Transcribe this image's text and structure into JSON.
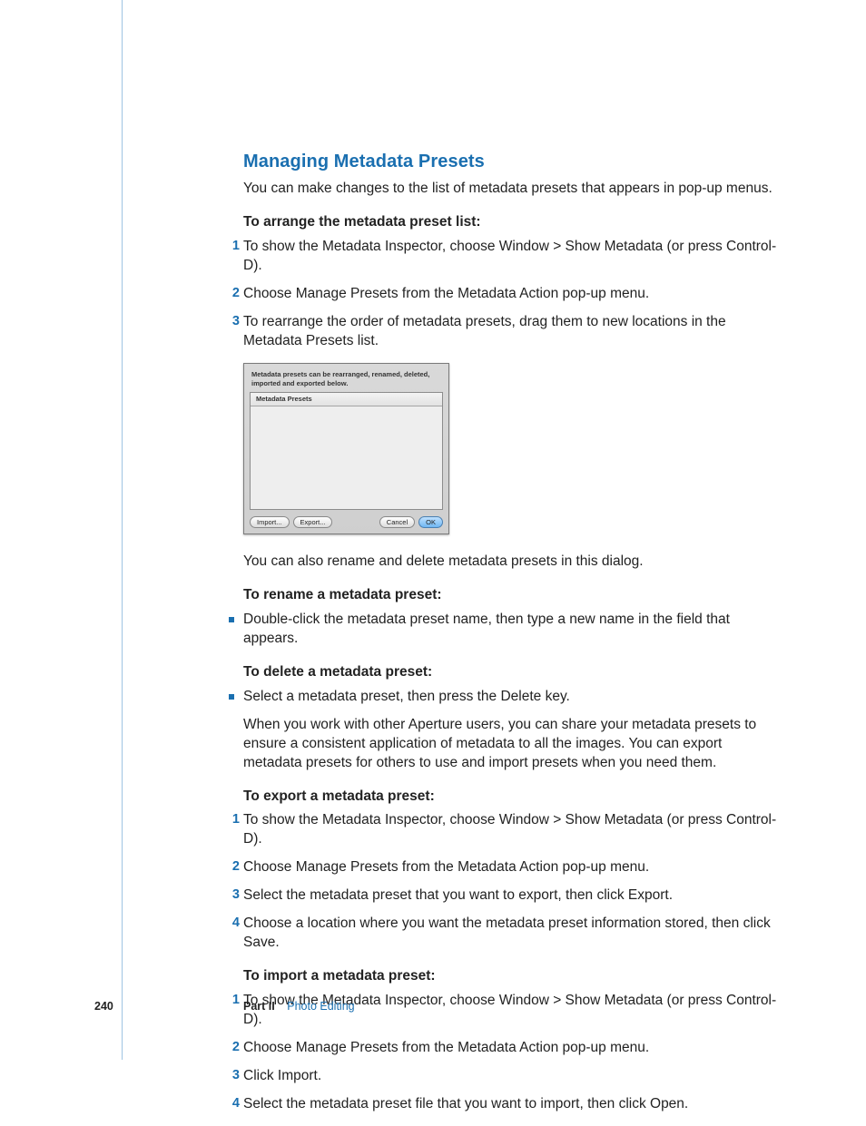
{
  "heading": "Managing Metadata Presets",
  "intro": "You can make changes to the list of metadata presets that appears in pop-up menus.",
  "arrange": {
    "head": "To arrange the metadata preset list:",
    "steps": [
      "To show the Metadata Inspector, choose Window > Show Metadata (or press Control-D).",
      "Choose Manage Presets from the Metadata Action pop-up menu.",
      "To rearrange the order of metadata presets, drag them to new locations in the Metadata Presets list."
    ]
  },
  "dialog": {
    "message": "Metadata presets can be rearranged, renamed, deleted, imported and exported below.",
    "listHeader": "Metadata Presets",
    "buttons": {
      "import": "Import...",
      "export": "Export...",
      "cancel": "Cancel",
      "ok": "OK"
    }
  },
  "afterDialog": "You can also rename and delete metadata presets in this dialog.",
  "rename": {
    "head": "To rename a metadata preset:",
    "bullet": "Double-click the metadata preset name, then type a new name in the field that appears."
  },
  "delete": {
    "head": "To delete a metadata preset:",
    "bullet": "Select a metadata preset, then press the Delete key.",
    "para": "When you work with other Aperture users, you can share your metadata presets to ensure a consistent application of metadata to all the images. You can export metadata presets for others to use and import presets when you need them."
  },
  "export": {
    "head": "To export a metadata preset:",
    "steps": [
      "To show the Metadata Inspector, choose Window > Show Metadata (or press Control-D).",
      "Choose Manage Presets from the Metadata Action pop-up menu.",
      "Select the metadata preset that you want to export, then click Export.",
      "Choose a location where you want the metadata preset information stored, then click Save."
    ]
  },
  "import": {
    "head": "To import a metadata preset:",
    "steps": [
      "To show the Metadata Inspector, choose Window > Show Metadata (or press Control-D).",
      "Choose Manage Presets from the Metadata Action pop-up menu.",
      "Click Import.",
      "Select the metadata preset file that you want to import, then click Open."
    ]
  },
  "footer": {
    "pageNumber": "240",
    "partLabel": "Part II",
    "partName": "Photo Editing"
  }
}
